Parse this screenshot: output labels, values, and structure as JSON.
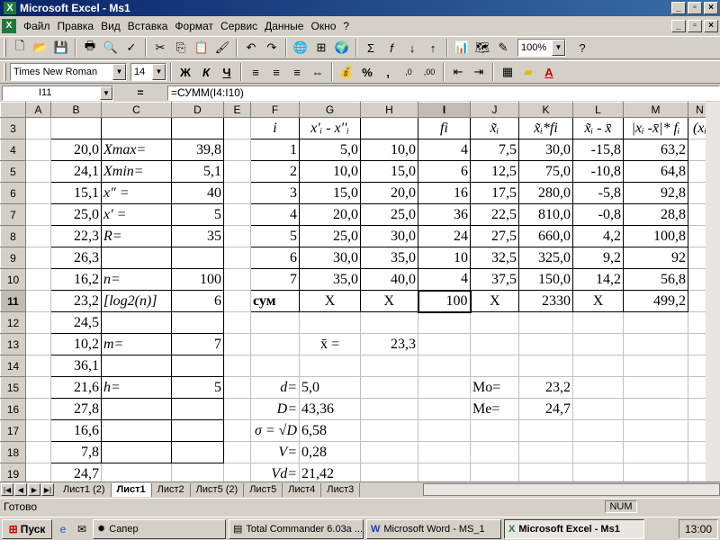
{
  "window": {
    "title": "Microsoft Excel - Ms1"
  },
  "menu": [
    "Файл",
    "Правка",
    "Вид",
    "Вставка",
    "Формат",
    "Сервис",
    "Данные",
    "Окно",
    "?"
  ],
  "toolbar1": {
    "zoom": "100%"
  },
  "toolbar2": {
    "font": "Times New Roman",
    "size": "14",
    "bold": "Ж",
    "italic": "К",
    "underline": "Ч"
  },
  "formula_bar": {
    "cell": "I11",
    "eq": "=",
    "formula": "=СУММ(I4:I10)"
  },
  "columns": [
    "A",
    "B",
    "C",
    "D",
    "E",
    "F",
    "G",
    "H",
    "I",
    "J",
    "K",
    "L",
    "M",
    "N"
  ],
  "rows": [
    {
      "n": "3",
      "cells": [
        "",
        "",
        "",
        "",
        "",
        "i",
        "x'ᵢ - x''ᵢ",
        "",
        "fi",
        "x̃ᵢ",
        "x̃ᵢ*fi",
        "x̃ᵢ - x̄",
        "|xᵢ -x̄|* fᵢ",
        "(xᵢ"
      ]
    },
    {
      "n": "4",
      "cells": [
        "",
        "20,0",
        "Xmax=",
        "39,8",
        "",
        "1",
        "5,0",
        "10,0",
        "4",
        "7,5",
        "30,0",
        "-15,8",
        "63,2",
        ""
      ]
    },
    {
      "n": "5",
      "cells": [
        "",
        "24,1",
        "Xmin=",
        "5,1",
        "",
        "2",
        "10,0",
        "15,0",
        "6",
        "12,5",
        "75,0",
        "-10,8",
        "64,8",
        ""
      ]
    },
    {
      "n": "6",
      "cells": [
        "",
        "15,1",
        "x″     =",
        "40",
        "",
        "3",
        "15,0",
        "20,0",
        "16",
        "17,5",
        "280,0",
        "-5,8",
        "92,8",
        ""
      ]
    },
    {
      "n": "7",
      "cells": [
        "",
        "25,0",
        "x′     =",
        "5",
        "",
        "4",
        "20,0",
        "25,0",
        "36",
        "22,5",
        "810,0",
        "-0,8",
        "28,8",
        ""
      ]
    },
    {
      "n": "8",
      "cells": [
        "",
        "22,3",
        "R=",
        "35",
        "",
        "5",
        "25,0",
        "30,0",
        "24",
        "27,5",
        "660,0",
        "4,2",
        "100,8",
        ""
      ]
    },
    {
      "n": "9",
      "cells": [
        "",
        "26,3",
        "",
        "",
        "",
        "6",
        "30,0",
        "35,0",
        "10",
        "32,5",
        "325,0",
        "9,2",
        "92",
        ""
      ]
    },
    {
      "n": "10",
      "cells": [
        "",
        "16,2",
        "n=",
        "100",
        "",
        "7",
        "35,0",
        "40,0",
        "4",
        "37,5",
        "150,0",
        "14,2",
        "56,8",
        ""
      ]
    },
    {
      "n": "11",
      "cells": [
        "",
        "23,2",
        "[log2(n)]",
        "6",
        "",
        "сум",
        "X",
        "X",
        "100",
        "X",
        "2330",
        "X",
        "499,2",
        ""
      ]
    },
    {
      "n": "12",
      "cells": [
        "",
        "24,5",
        "",
        "",
        "",
        "",
        "",
        "",
        "",
        "",
        "",
        "",
        "",
        ""
      ]
    },
    {
      "n": "13",
      "cells": [
        "",
        "10,2",
        "m=",
        "7",
        "",
        "",
        "x̄    =",
        "23,3",
        "",
        "",
        "",
        "",
        "",
        ""
      ]
    },
    {
      "n": "14",
      "cells": [
        "",
        "36,1",
        "",
        "",
        "",
        "",
        "",
        "",
        "",
        "",
        "",
        "",
        "",
        ""
      ]
    },
    {
      "n": "15",
      "cells": [
        "",
        "21,6",
        "h=",
        "5",
        "",
        "d=",
        "5,0",
        "",
        "",
        "Mo=",
        "23,2",
        "",
        "",
        ""
      ]
    },
    {
      "n": "16",
      "cells": [
        "",
        "27,8",
        "",
        "",
        "",
        "D=",
        "43,36",
        "",
        "",
        "Me=",
        "24,7",
        "",
        "",
        ""
      ]
    },
    {
      "n": "17",
      "cells": [
        "",
        "16,6",
        "",
        "",
        "",
        "σ = √D",
        "6,58",
        "",
        "",
        "",
        "",
        "",
        "",
        ""
      ]
    },
    {
      "n": "18",
      "cells": [
        "",
        "7,8",
        "",
        "",
        "",
        "V=",
        "0,28",
        "",
        "",
        "",
        "",
        "",
        "",
        ""
      ]
    },
    {
      "n": "19",
      "cells": [
        "",
        "24,7",
        "",
        "",
        "",
        "Vd=",
        "21,42",
        "",
        "",
        "",
        "",
        "",
        "",
        ""
      ]
    }
  ],
  "sheet_tabs": [
    "Лист1 (2)",
    "Лист1",
    "Лист2",
    "Лист5 (2)",
    "Лист5",
    "Лист4",
    "Лист3"
  ],
  "active_tab": "Лист1",
  "status": {
    "text": "Готово",
    "num": "NUM"
  },
  "taskbar": {
    "start": "Пуск",
    "items": [
      "Сапер",
      "Total Commander 6.03a ...",
      "Microsoft Word - MS_1",
      "Microsoft Excel - Ms1"
    ],
    "clock": "13:00"
  }
}
